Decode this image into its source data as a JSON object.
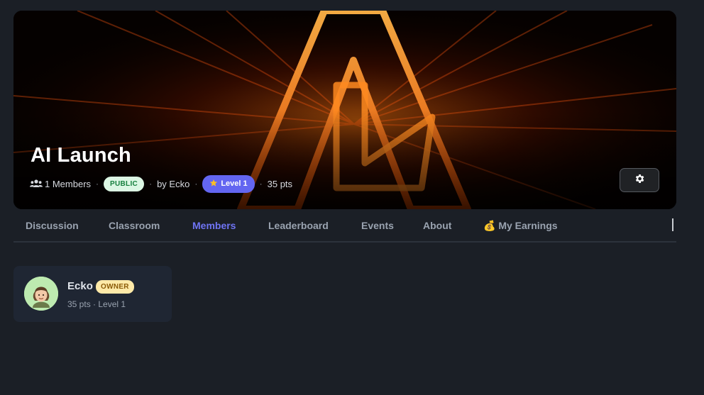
{
  "community": {
    "title": "AI Launch",
    "members_label": "1 Members",
    "visibility_badge": "PUBLIC",
    "author_label": "by Ecko",
    "level_badge": "Level 1",
    "points_label": "35 pts",
    "dot_separator": "·"
  },
  "tabs": [
    {
      "label": "Discussion",
      "active": false
    },
    {
      "label": "Classroom",
      "active": false
    },
    {
      "label": "Members",
      "active": true
    },
    {
      "label": "Leaderboard",
      "active": false
    },
    {
      "label": "Events",
      "active": false
    },
    {
      "label": "About",
      "active": false
    },
    {
      "label": "💰 My Earnings",
      "active": false
    }
  ],
  "members": [
    {
      "name": "Ecko",
      "role_badge": "OWNER",
      "stats": "35 pts · Level 1"
    }
  ],
  "colors": {
    "accent": "#6366f1",
    "active_tab": "#6f74f4",
    "public_badge_bg": "#dcf7e4",
    "owner_badge_bg": "#fde9a8"
  },
  "icons": {
    "members": "users-icon",
    "level": "star-icon",
    "settings": "gear-icon"
  }
}
